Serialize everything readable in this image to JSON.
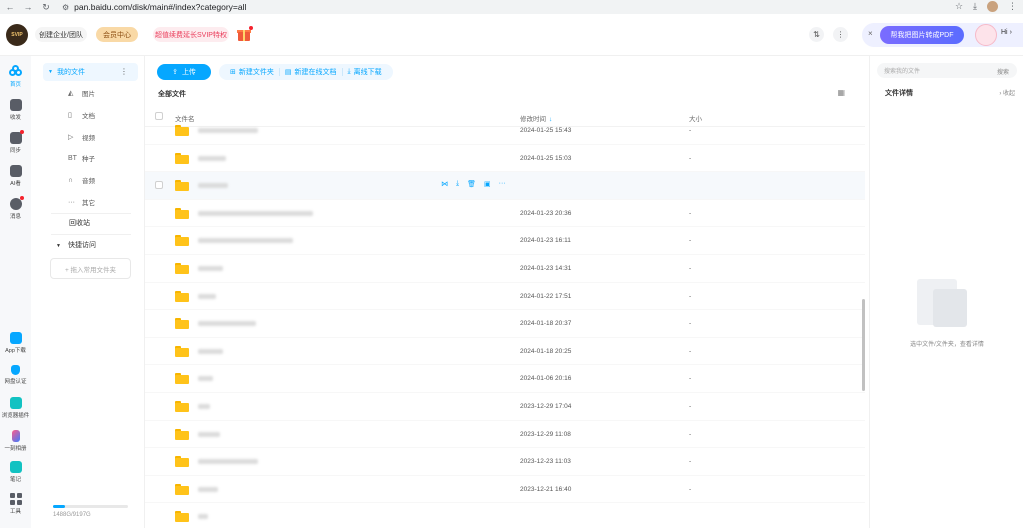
{
  "browser": {
    "url": "pan.baidu.com/disk/main#/index?category=all"
  },
  "header": {
    "team_btn": "创建企业/团队",
    "vip_btn": "会员中心",
    "promo_btn": "超值续费延长SVIP特权",
    "pdf_btn": "帮我把图片转成PDF",
    "greeting": "Hi",
    "logo_text": "SVIP"
  },
  "rail": [
    {
      "label": "首页",
      "icon": "home-icon",
      "active": true
    },
    {
      "label": "收发",
      "icon": "inbox-icon"
    },
    {
      "label": "同步",
      "icon": "sync-icon",
      "badge": true
    },
    {
      "label": "AI看",
      "icon": "ai-view-icon"
    },
    {
      "label": "消息",
      "icon": "message-icon",
      "badge": true
    },
    {
      "label": "App下载",
      "icon": "app-download-icon"
    },
    {
      "label": "网盘认证",
      "icon": "verify-icon"
    },
    {
      "label": "浏览器插件",
      "icon": "plugin-icon"
    },
    {
      "label": "一刻相册",
      "icon": "album-icon"
    },
    {
      "label": "笔记",
      "icon": "note-icon"
    },
    {
      "label": "工具",
      "icon": "tools-icon"
    }
  ],
  "sidebar": {
    "my_files": "我的文件",
    "categories": [
      {
        "label": "图片",
        "icon": "image-icon"
      },
      {
        "label": "文档",
        "icon": "document-icon"
      },
      {
        "label": "视频",
        "icon": "video-icon"
      },
      {
        "label": "种子",
        "icon": "torrent-icon"
      },
      {
        "label": "音频",
        "icon": "audio-icon"
      },
      {
        "label": "其它",
        "icon": "other-icon"
      }
    ],
    "recycle": "回收站",
    "quick_access": "快捷访问",
    "add_folder": "+ 拖入常用文件夹",
    "storage": "1488G/9197G",
    "storage_used_fraction": 0.16
  },
  "toolbar": {
    "upload": "上传",
    "new_folder": "新建文件夹",
    "new_online_doc": "新建在线文档",
    "offline_download": "离线下载"
  },
  "breadcrumb": "全部文件",
  "table": {
    "col_name": "文件名",
    "col_modified": "修改时间",
    "col_size": "大小",
    "rows": [
      {
        "date": "2024-01-25 15:43",
        "size": "-"
      },
      {
        "date": "2024-01-25 15:03",
        "size": "-"
      },
      {
        "date": "",
        "size": "",
        "hover": true
      },
      {
        "date": "2024-01-23 20:36",
        "size": "-"
      },
      {
        "date": "2024-01-23 16:11",
        "size": "-"
      },
      {
        "date": "2024-01-23 14:31",
        "size": "-"
      },
      {
        "date": "2024-01-22 17:51",
        "size": "-"
      },
      {
        "date": "2024-01-18 20:37",
        "size": "-"
      },
      {
        "date": "2024-01-18 20:25",
        "size": "-"
      },
      {
        "date": "2024-01-06 20:16",
        "size": "-"
      },
      {
        "date": "2023-12-29 17:04",
        "size": "-"
      },
      {
        "date": "2023-12-29 11:08",
        "size": "-"
      },
      {
        "date": "2023-12-23 11:03",
        "size": "-"
      },
      {
        "date": "2023-12-21 16:40",
        "size": "-"
      },
      {
        "date": "",
        "size": ""
      }
    ]
  },
  "right_panel": {
    "search_placeholder": "搜索我的文件",
    "search_btn": "搜索",
    "title": "文件详情",
    "collapse": "收起",
    "hint": "选中文件/文件夹，查看详情"
  }
}
